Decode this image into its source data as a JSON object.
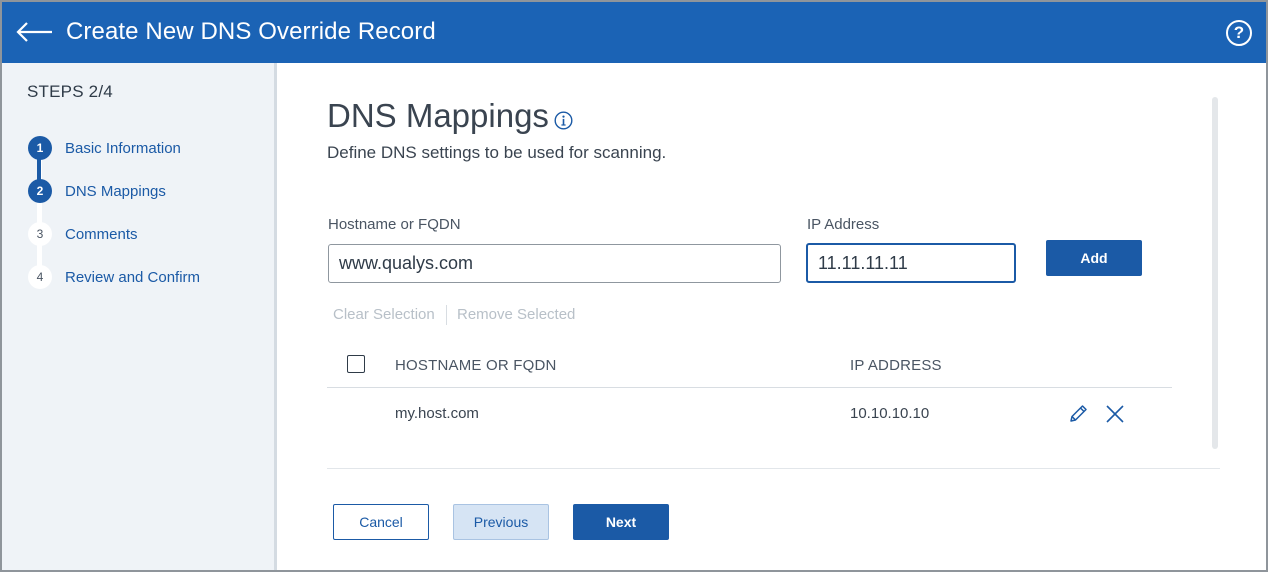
{
  "header": {
    "title": "Create New DNS Override Record",
    "back_icon": "arrow-left-icon",
    "help_label": "?",
    "background": "#1b63b5"
  },
  "sidebar": {
    "steps_title": "STEPS 2/4",
    "steps": [
      {
        "number": "1",
        "label": "Basic Information",
        "state": "completed"
      },
      {
        "number": "2",
        "label": "DNS Mappings",
        "state": "active"
      },
      {
        "number": "3",
        "label": "Comments",
        "state": "pending"
      },
      {
        "number": "4",
        "label": "Review and Confirm",
        "state": "pending"
      }
    ]
  },
  "main": {
    "title": "DNS Mappings",
    "info_icon": "info-icon",
    "subtitle": "Define DNS settings to be used for scanning.",
    "hostname_label": "Hostname or FQDN",
    "hostname_value": "www.qualys.com",
    "ip_label": "IP Address",
    "ip_value": "11.11.11.11",
    "add_label": "Add",
    "clear_selection_label": "Clear Selection",
    "remove_selected_label": "Remove Selected",
    "table": {
      "columns": [
        "HOSTNAME OR FQDN",
        "IP ADDRESS"
      ],
      "rows": [
        {
          "hostname": "my.host.com",
          "ip": "10.10.10.10"
        }
      ]
    },
    "footer": {
      "cancel_label": "Cancel",
      "previous_label": "Previous",
      "next_label": "Next"
    }
  },
  "colors": {
    "accent": "#1b5aa6",
    "sidebar_bg": "#eff3f7",
    "disabled_text": "#b8c0c8"
  }
}
